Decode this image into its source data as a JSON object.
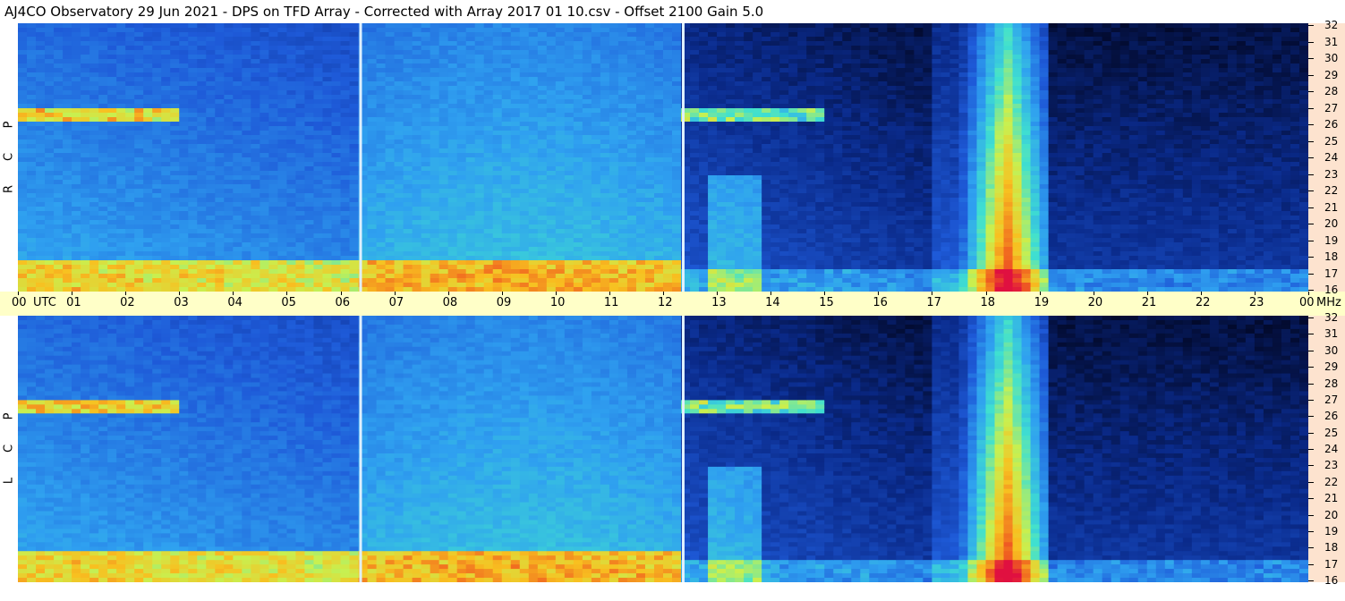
{
  "title": "AJ4CO Observatory  29 Jun 2021  -  DPS on TFD Array  -  Corrected with Array 2017 01 10.csv  -  Offset 2100  Gain 5.0",
  "time_axis": {
    "start_label": "00",
    "utc_label": "UTC",
    "hour_labels": [
      "01",
      "02",
      "03",
      "04",
      "05",
      "06",
      "07",
      "08",
      "09",
      "10",
      "11",
      "12",
      "13",
      "14",
      "15",
      "16",
      "17",
      "18",
      "19",
      "20",
      "21",
      "22",
      "23"
    ],
    "end_label": "00",
    "unit_label": "MHz"
  },
  "panels": {
    "top": {
      "polarization_letters": [
        "R",
        "C",
        "P"
      ]
    },
    "bottom": {
      "polarization_letters": [
        "L",
        "C",
        "P"
      ]
    }
  },
  "chart_data": {
    "type": "heatmap",
    "title": "AJ4CO Observatory  29 Jun 2021  -  DPS on TFD Array  -  Corrected with Array 2017 01 10.csv  -  Offset 2100  Gain 5.0",
    "x_axis": {
      "label": "UTC",
      "range": [
        0,
        24
      ],
      "ticks": [
        "00",
        "01",
        "02",
        "03",
        "04",
        "05",
        "06",
        "07",
        "08",
        "09",
        "10",
        "11",
        "12",
        "13",
        "14",
        "15",
        "16",
        "17",
        "18",
        "19",
        "20",
        "21",
        "22",
        "23",
        "00"
      ]
    },
    "y_axis": {
      "label": "MHz",
      "range": [
        16,
        32
      ],
      "ticks": [
        "16",
        "17",
        "18",
        "19",
        "20",
        "21",
        "22",
        "23",
        "24",
        "25",
        "26",
        "27",
        "28",
        "29",
        "30",
        "31",
        "32"
      ]
    },
    "panels": [
      "RCP",
      "LCP"
    ],
    "colormap": [
      "#000010",
      "#0a2a8a",
      "#1e5ad8",
      "#2fa0f0",
      "#3fe0d0",
      "#c8f050",
      "#f8c020",
      "#f06020",
      "#e01040"
    ],
    "features": [
      {
        "description_hours": [
          17.0,
          19.2
        ],
        "strength": "high",
        "center_hour": 18.4
      },
      {
        "marker_hours": [
          6.35,
          12.35
        ]
      }
    ]
  }
}
